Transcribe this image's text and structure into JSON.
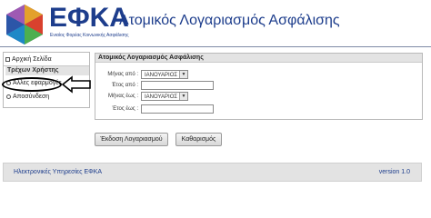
{
  "header": {
    "brand": "ΕΦΚΑ",
    "brand_subtitle": "Ενιαίος Φορέας Κοινωνικής Ασφάλισης",
    "title": "Ατομικός Λογαριασμός Ασφάλισης"
  },
  "sidebar": {
    "home": "Αρχική Σελίδα",
    "section_title": "Τρέχων Χρήστης",
    "items": [
      {
        "label": "Άλλες εφαρμογές"
      },
      {
        "label": "Αποσύνδεση"
      }
    ]
  },
  "panel": {
    "title": "Ατομικός Λογαριασμός Ασφάλισης",
    "month_from_label": "Μήνας από :",
    "month_from_value": "ΙΑΝΟΥΑΡΙΟΣ",
    "year_from_label": "Έτος από :",
    "month_to_label": "Μήνας έως :",
    "month_to_value": "ΙΑΝΟΥΑΡΙΟΣ",
    "year_to_label": "Έτος έως :"
  },
  "buttons": {
    "issue": "Έκδοση Λογαριασμού",
    "clear": "Καθαρισμός"
  },
  "footer": {
    "left": "Ηλεκτρονικές Υπηρεσίες ΕΦΚΑ",
    "right": "version 1.0"
  },
  "colors": {
    "brand_blue": "#1d3d8c",
    "panel_header_bg": "#e3e3e3"
  }
}
